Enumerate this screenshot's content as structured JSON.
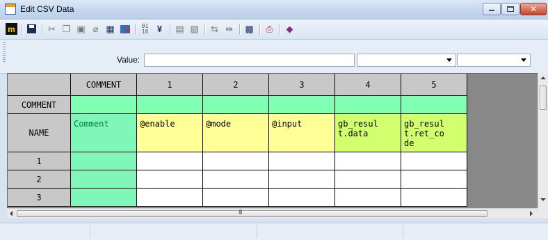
{
  "window": {
    "title": "Edit CSV Data"
  },
  "toolbar": {
    "icons": [
      "app-logo-icon",
      "save-icon",
      "cut-icon",
      "copy-icon",
      "paste-icon",
      "eraser-icon",
      "grid-icon",
      "delete-sheet-icon",
      "binary-icon",
      "currency-icon",
      "import-icon",
      "export-icon",
      "link-icon",
      "unlink-icon",
      "table-settings-icon",
      "print-icon",
      "book-icon"
    ]
  },
  "valuebar": {
    "label": "Value:",
    "value": "",
    "combo1": "",
    "combo2": ""
  },
  "grid": {
    "corner": "",
    "columns": [
      "COMMENT",
      "1",
      "2",
      "3",
      "4",
      "5"
    ],
    "rows": [
      {
        "header": "COMMENT",
        "cells": [
          "",
          "",
          "",
          "",
          "",
          ""
        ]
      },
      {
        "header": "NAME",
        "cells": [
          "Comment",
          "@enable",
          "@mode",
          "@input",
          "gb_resul\nt.data",
          "gb_resul\nt.ret_co\nde"
        ]
      },
      {
        "header": "1",
        "cells": [
          "",
          "",
          "",
          "",
          "",
          ""
        ]
      },
      {
        "header": "2",
        "cells": [
          "",
          "",
          "",
          "",
          "",
          ""
        ]
      },
      {
        "header": "3",
        "cells": [
          "",
          "",
          "",
          "",
          "",
          ""
        ]
      }
    ],
    "colors": {
      "header": "#c8c8c8",
      "comment_col": "#7ff7b8",
      "comment_row": "#80ffb3",
      "name_row": "#ffff96",
      "name_row_alt": "#d2ff6e",
      "body": "#ffffff",
      "comment_text": "#008040"
    }
  },
  "scrollbar": {
    "h_thumb_glyph": "III"
  }
}
